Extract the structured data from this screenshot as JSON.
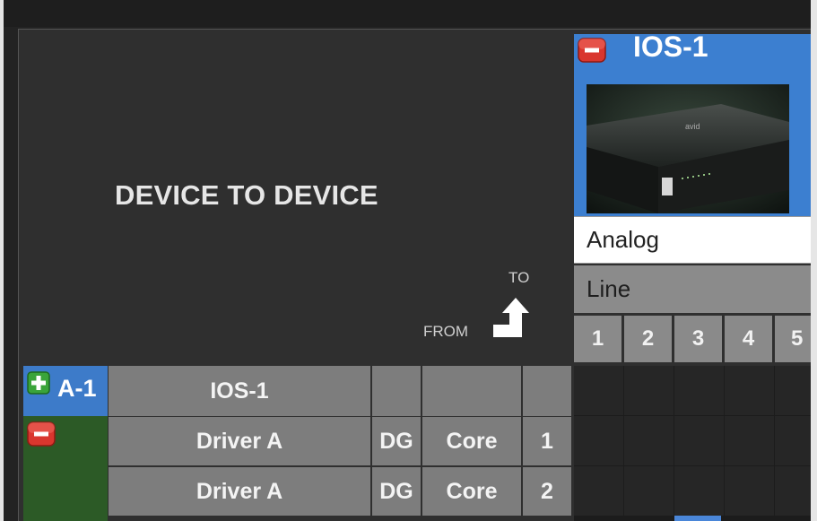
{
  "panel": {
    "title": "DEVICE TO DEVICE",
    "to_label": "TO",
    "from_label": "FROM"
  },
  "device": {
    "name": "IOS-1",
    "format": "Analog",
    "signal": "Line",
    "channels": [
      "1",
      "2",
      "3",
      "4",
      "5"
    ]
  },
  "source_group": {
    "name": "A-1",
    "device": "IOS-1"
  },
  "rows": [
    {
      "name": "Driver A",
      "type": "DG",
      "class": "Core",
      "number": "1"
    },
    {
      "name": "Driver A",
      "type": "DG",
      "class": "Core",
      "number": "2"
    }
  ],
  "colors": {
    "accent_blue": "#3c7fd0",
    "remove_red": "#d9362e",
    "add_green": "#3aa43a",
    "row_green": "#2c5a26"
  }
}
